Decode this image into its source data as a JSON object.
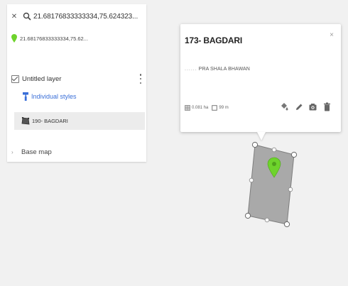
{
  "search": {
    "query": "21.68176833333334,75.624323...",
    "result": "21.68176833333334,75.62..."
  },
  "layers": {
    "layer_name": "Untitled layer",
    "styles_label": "Individual styles",
    "feature_label": "190- BAGDARI",
    "basemap_label": "Base map"
  },
  "popup": {
    "title": "173- BAGDARI",
    "description_prefix": "......",
    "description": "PRA SHALA BHAWAN",
    "area": "0.081 ha",
    "perimeter": "99 m",
    "close": "×"
  },
  "colors": {
    "accent_blue": "#3a6fd8",
    "pin_green": "#6ed32c",
    "polygon_fill": "#a9a9a9"
  }
}
